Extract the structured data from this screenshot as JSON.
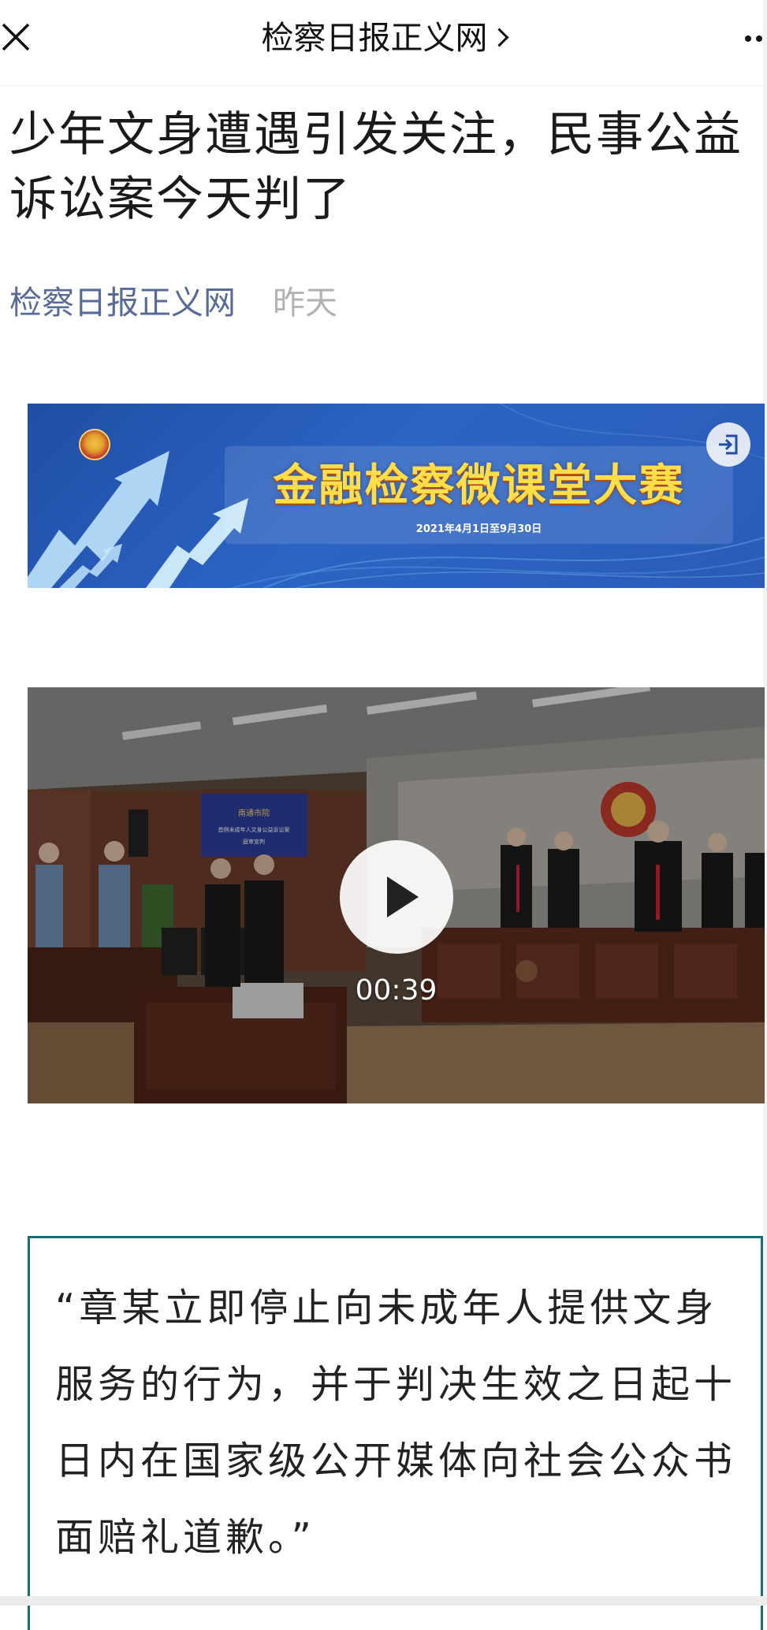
{
  "nav": {
    "title": "检察日报正义网",
    "close_icon": "close-icon",
    "more_icon": "more-dots-icon"
  },
  "article": {
    "headline": "少年文身遭遇引发关注，民事公益诉讼案今天判了",
    "source": "检察日报正义网",
    "date": "昨天"
  },
  "banner": {
    "title": "金融检察微课堂大赛",
    "date_range": "2021年4月1日至9月30日",
    "emblem_icon": "national-emblem-icon",
    "exit_icon": "exit-icon",
    "arrow_icon": "growth-arrows-icon",
    "accent": "#1f4ea6"
  },
  "video": {
    "duration": "00:39",
    "play_icon": "play-icon",
    "screen_title": "南通市院",
    "screen_subtitle": "首例未成年人文身公益诉讼案",
    "screen_sub2": "庭审宣判"
  },
  "quote": {
    "text": "“章某立即停止向未成年人提供文身服务的行为，并于判决生效之日起十日内在国家级公开媒体向社会公众书面赔礼道歉。”",
    "border_color": "#1d6b73"
  }
}
